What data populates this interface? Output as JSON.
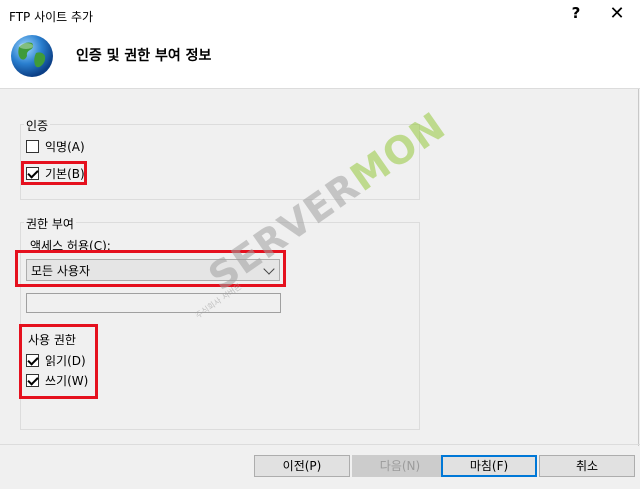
{
  "window": {
    "title": "FTP 사이트 추가",
    "help": "?",
    "close": "✕"
  },
  "header": {
    "title": "인증 및 권한 부여 정보",
    "icon": "globe-icon"
  },
  "auth": {
    "group_label": "인증",
    "anonymous": {
      "label": "익명(A)",
      "checked": false
    },
    "basic": {
      "label": "기본(B)",
      "checked": true
    }
  },
  "authorization": {
    "group_label": "권한 부여",
    "allow_label": "액세스 허용(C):",
    "allow_value": "모든 사용자",
    "text_value": "",
    "perm_label": "사용 권한",
    "read": {
      "label": "읽기(D)",
      "checked": true
    },
    "write": {
      "label": "쓰기(W)",
      "checked": true
    }
  },
  "buttons": {
    "prev": "이전(P)",
    "next": "다음(N)",
    "finish": "마침(F)",
    "cancel": "취소"
  },
  "watermark": {
    "text_main": "SERVER",
    "text_on": "MON",
    "sub": "주식회사 서버몬"
  },
  "colors": {
    "highlight_box": "#e5101e",
    "accent": "#0078d7"
  }
}
